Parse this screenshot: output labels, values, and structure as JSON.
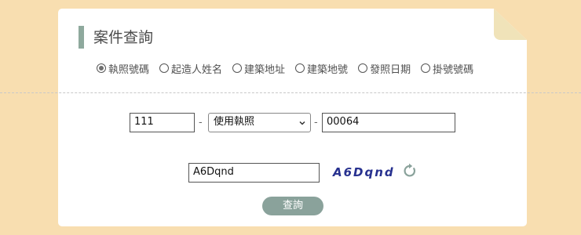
{
  "panel": {
    "title": "案件查詢"
  },
  "search_type": {
    "options": [
      {
        "label": "執照號碼",
        "checked": true
      },
      {
        "label": "起造人姓名",
        "checked": false
      },
      {
        "label": "建築地址",
        "checked": false
      },
      {
        "label": "建築地號",
        "checked": false
      },
      {
        "label": "發照日期",
        "checked": false
      },
      {
        "label": "掛號號碼",
        "checked": false
      }
    ]
  },
  "license": {
    "year_value": "111",
    "separator": "-",
    "type_selected": "使用執照",
    "number_value": "00064"
  },
  "captcha": {
    "input_value": "A6Dqnd",
    "image_text": "A6Dqnd",
    "refresh_icon": "refresh-icon"
  },
  "actions": {
    "query_label": "查詢"
  },
  "colors": {
    "background": "#f8deb0",
    "accent": "#8ea99d",
    "button": "#8aa29b",
    "captcha": "#27318f"
  }
}
